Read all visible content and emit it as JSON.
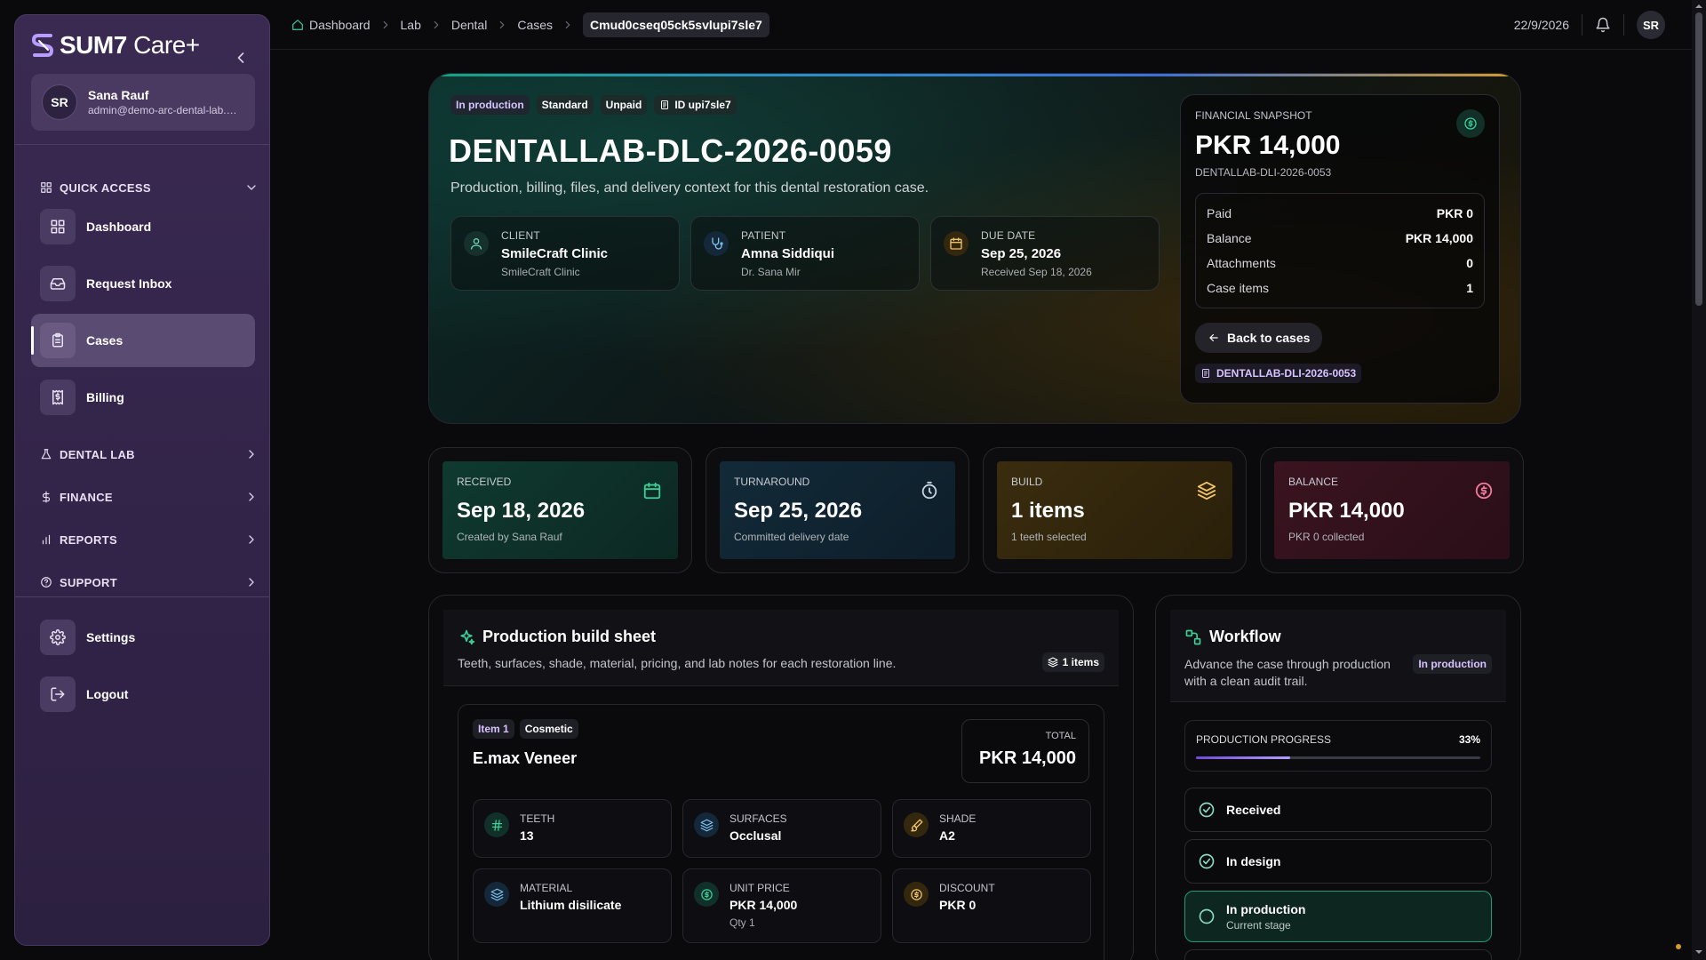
{
  "app": {
    "brand_bold": "SUM7",
    "brand_light": "Care+"
  },
  "user": {
    "initials": "SR",
    "name": "Sana Rauf",
    "email": "admin@demo-arc-dental-lab.e..."
  },
  "sidebar": {
    "quick_access": "QUICK ACCESS",
    "items": [
      {
        "label": "Dashboard",
        "icon": "grid-icon"
      },
      {
        "label": "Request Inbox",
        "icon": "inbox-icon"
      },
      {
        "label": "Cases",
        "icon": "clipboard-icon",
        "active": true
      },
      {
        "label": "Billing",
        "icon": "receipt-dollar-icon"
      }
    ],
    "sections": [
      "DENTAL LAB",
      "FINANCE",
      "REPORTS",
      "SUPPORT"
    ],
    "bottom": [
      {
        "label": "Settings",
        "icon": "gear-icon"
      },
      {
        "label": "Logout",
        "icon": "logout-icon"
      }
    ]
  },
  "breadcrumb": {
    "items": [
      "Dashboard",
      "Lab",
      "Dental",
      "Cases"
    ],
    "current": "Cmud0cseq05ck5svlupi7sle7"
  },
  "topbar": {
    "date": "22/9/2026",
    "avatar": "SR"
  },
  "hero": {
    "badges": [
      "In production",
      "Standard",
      "Unpaid",
      "ID upi7sle7"
    ],
    "title": "DENTALLAB-DLC-2026-0059",
    "subtitle": "Production, billing, files, and delivery context for this dental restoration case.",
    "cards": [
      {
        "label": "CLIENT",
        "main": "SmileCraft Clinic",
        "sub": "SmileCraft Clinic",
        "icon": "user-icon"
      },
      {
        "label": "PATIENT",
        "main": "Amna Siddiqui",
        "sub": "Dr. Sana Mir",
        "icon": "stethoscope-icon"
      },
      {
        "label": "DUE DATE",
        "main": "Sep 25, 2026",
        "sub": "Received Sep 18, 2026",
        "icon": "calendar-icon"
      }
    ]
  },
  "snapshot": {
    "label": "FINANCIAL SNAPSHOT",
    "amount": "PKR 14,000",
    "ref": "DENTALLAB-DLI-2026-0053",
    "rows": [
      {
        "k": "Paid",
        "v": "PKR 0"
      },
      {
        "k": "Balance",
        "v": "PKR 14,000"
      },
      {
        "k": "Attachments",
        "v": "0"
      },
      {
        "k": "Case items",
        "v": "1"
      }
    ],
    "back": "Back to cases",
    "invoice_chip": "DENTALLAB-DLI-2026-0053"
  },
  "stats": [
    {
      "label": "RECEIVED",
      "value": "Sep 18, 2026",
      "sub": "Created by Sana Rauf",
      "icon": "calendar-icon",
      "color": "#3ccf99"
    },
    {
      "label": "TURNAROUND",
      "value": "Sep 25, 2026",
      "sub": "Committed delivery date",
      "icon": "timer-icon",
      "color": "#c9d2e0"
    },
    {
      "label": "BUILD",
      "value": "1 items",
      "sub": "1 teeth selected",
      "icon": "layers-icon",
      "color": "#f0c36a"
    },
    {
      "label": "BALANCE",
      "value": "PKR 14,000",
      "sub": "PKR 0 collected",
      "icon": "dollar-circle-icon",
      "color": "#f07a9a"
    }
  ],
  "build": {
    "title": "Production build sheet",
    "subtitle": "Teeth, surfaces, shade, material, pricing, and lab notes for each restoration line.",
    "chip": "1 items",
    "item": {
      "badges": [
        "Item 1",
        "Cosmetic"
      ],
      "name": "E.max Veneer",
      "total_label": "TOTAL",
      "total": "PKR 14,000",
      "fields": [
        {
          "label": "TEETH",
          "value": "13",
          "sub": "",
          "icon": "hash-icon"
        },
        {
          "label": "SURFACES",
          "value": "Occlusal",
          "sub": "",
          "icon": "layers-icon"
        },
        {
          "label": "SHADE",
          "value": "A2",
          "sub": "",
          "icon": "paintbrush-icon"
        },
        {
          "label": "MATERIAL",
          "value": "Lithium disilicate",
          "sub": "",
          "icon": "layers-icon"
        },
        {
          "label": "UNIT PRICE",
          "value": "PKR 14,000",
          "sub": "Qty 1",
          "icon": "dollar-circle-icon"
        },
        {
          "label": "DISCOUNT",
          "value": "PKR 0",
          "sub": "",
          "icon": "dollar-circle-icon"
        }
      ]
    }
  },
  "workflow": {
    "title": "Workflow",
    "subtitle": "Advance the case through production with a clean audit trail.",
    "chip": "In production",
    "progress_label": "PRODUCTION PROGRESS",
    "progress_text": "33%",
    "progress": 0.33,
    "stages": [
      {
        "label": "Received",
        "sub": ""
      },
      {
        "label": "In design",
        "sub": ""
      },
      {
        "label": "In production",
        "sub": "Current stage"
      }
    ]
  }
}
